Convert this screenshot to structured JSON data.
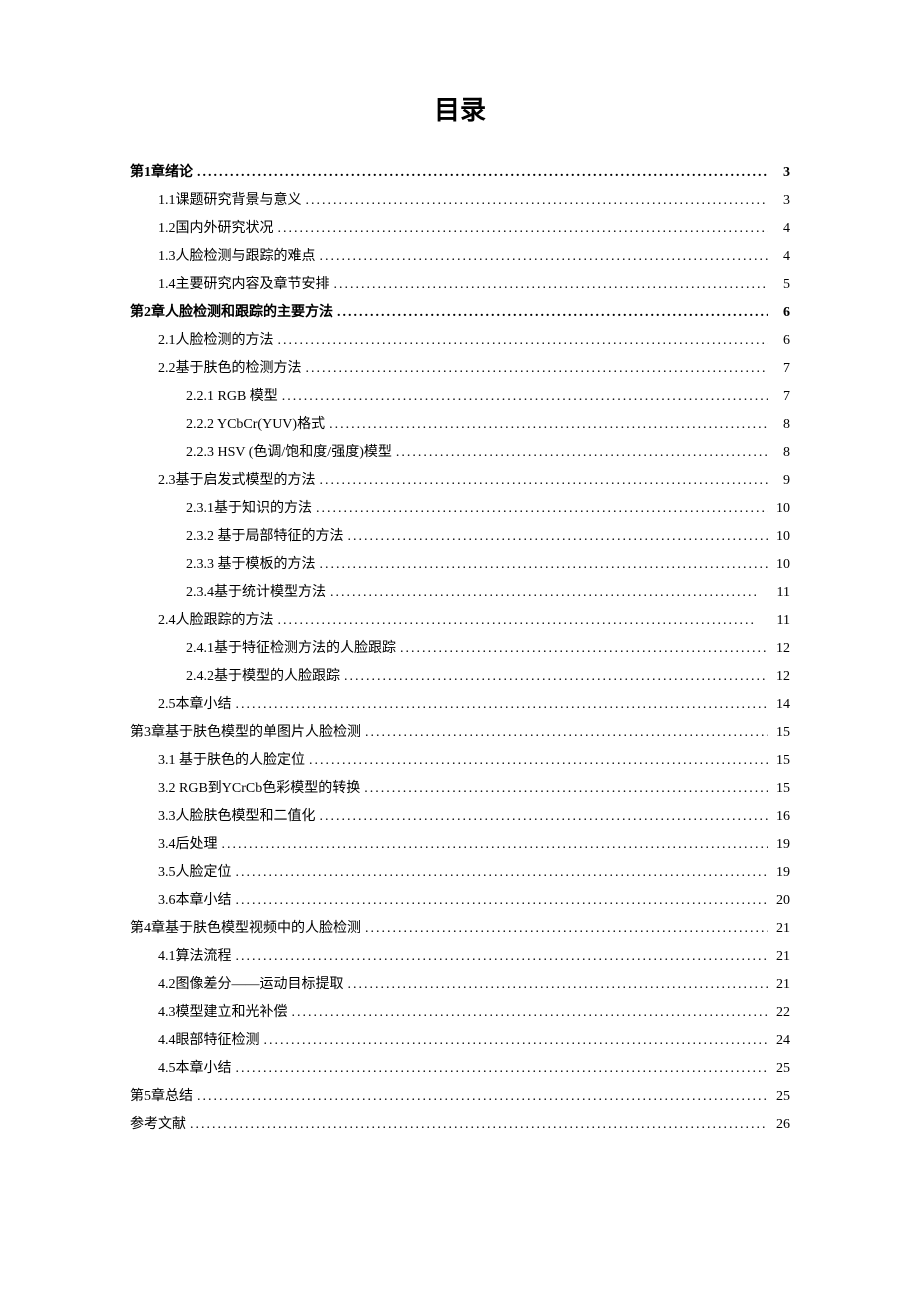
{
  "title": "目录",
  "entries": [
    {
      "label": "第1章绪论",
      "page": "3",
      "level": 0,
      "bold": true
    },
    {
      "label": "1.1课题研究背景与意义",
      "page": "3",
      "level": 1
    },
    {
      "label": "1.2国内外研究状况",
      "page": "4",
      "level": 1
    },
    {
      "label": "1.3人脸检测与跟踪的难点",
      "page": "4",
      "level": 1
    },
    {
      "label": "1.4主要研究内容及章节安排",
      "page": "5",
      "level": 1
    },
    {
      "label": "第2章人脸检测和跟踪的主要方法",
      "page": "6",
      "level": 0,
      "bold": true
    },
    {
      "label": "2.1人脸检测的方法",
      "page": "6",
      "level": 1
    },
    {
      "label": "2.2基于肤色的检测方法",
      "page": "7",
      "level": 1
    },
    {
      "label": "2.2.1 RGB 模型",
      "page": "7",
      "level": 2
    },
    {
      "label": "2.2.2 YCbCr(YUV)格式",
      "page": "8",
      "level": 2
    },
    {
      "label": "2.2.3 HSV (色调/饱和度/强度)模型",
      "page": "8",
      "level": 2
    },
    {
      "label": "2.3基于启发式模型的方法",
      "page": "9",
      "level": 1
    },
    {
      "label": "2.3.1基于知识的方法",
      "page": "10",
      "level": 2
    },
    {
      "label": "2.3.2 基于局部特征的方法",
      "page": "10",
      "level": 2
    },
    {
      "label": "2.3.3 基于模板的方法",
      "page": "10",
      "level": 2
    },
    {
      "label": "2.3.4基于统计模型方法",
      "page": "11",
      "level": 2,
      "wide": true
    },
    {
      "label": "2.4人脸跟踪的方法",
      "page": "11",
      "level": 1,
      "wide": true
    },
    {
      "label": "2.4.1基于特征检测方法的人脸跟踪",
      "page": "12",
      "level": 2
    },
    {
      "label": "2.4.2基于模型的人脸跟踪",
      "page": "12",
      "level": 2
    },
    {
      "label": "2.5本章小结",
      "page": "14",
      "level": 1
    },
    {
      "label": "第3章基于肤色模型的单图片人脸检测",
      "page": "15",
      "level": 0,
      "bold": false
    },
    {
      "label": "3.1 基于肤色的人脸定位",
      "page": "15",
      "level": 1
    },
    {
      "label": "3.2 RGB到YCrCb色彩模型的转换",
      "page": "15",
      "level": 1
    },
    {
      "label": "3.3人脸肤色模型和二值化",
      "page": "16",
      "level": 1
    },
    {
      "label": "3.4后处理",
      "page": "19",
      "level": 1
    },
    {
      "label": "3.5人脸定位",
      "page": "19",
      "level": 1
    },
    {
      "label": "3.6本章小结",
      "page": "20",
      "level": 1
    },
    {
      "label": "第4章基于肤色模型视频中的人脸检测",
      "page": "21",
      "level": 0,
      "bold": false
    },
    {
      "label": "4.1算法流程",
      "page": "21",
      "level": 1
    },
    {
      "label": "4.2图像差分——运动目标提取",
      "page": "21",
      "level": 1
    },
    {
      "label": "4.3模型建立和光补偿",
      "page": "22",
      "level": 1
    },
    {
      "label": "4.4眼部特征检测",
      "page": "24",
      "level": 1
    },
    {
      "label": "4.5本章小结",
      "page": "25",
      "level": 1
    },
    {
      "label": "第5章总结",
      "page": "25",
      "level": 0,
      "bold": false
    },
    {
      "label": "参考文献",
      "page": "26",
      "level": 0,
      "bold": false
    }
  ]
}
